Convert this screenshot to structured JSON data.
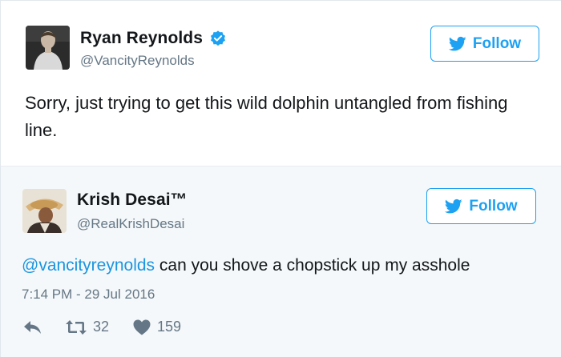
{
  "tweet1": {
    "display_name": "Ryan Reynolds",
    "handle": "@VancityReynolds",
    "follow_label": "Follow",
    "text": "Sorry, just trying to get this wild dolphin untangled from fishing line.",
    "verified_icon": "verified-badge-icon",
    "colors": {
      "accent": "#1da1f2",
      "text": "#14171a",
      "muted": "#657786"
    }
  },
  "tweet2": {
    "display_name": "Krish Desai™",
    "handle": "@RealKrishDesai",
    "follow_label": "Follow",
    "mention": "@vancityreynolds",
    "text_rest": " can you shove a chopstick up my asshole",
    "timestamp": "7:14 PM - 29 Jul 2016",
    "actions": {
      "reply_icon": "reply-icon",
      "retweet_icon": "retweet-icon",
      "retweet_count": "32",
      "like_icon": "heart-icon",
      "like_count": "159"
    },
    "colors": {
      "background": "#f5f8fa",
      "mention": "#1b95e0"
    }
  }
}
